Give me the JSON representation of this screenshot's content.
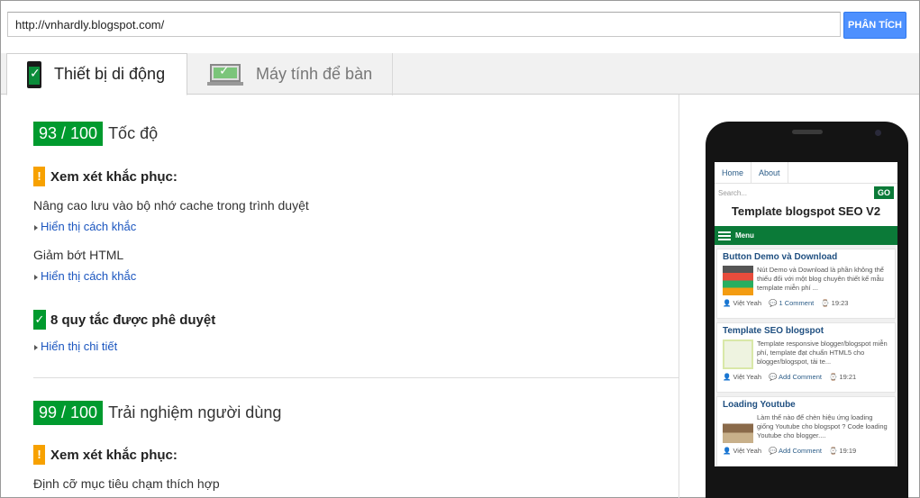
{
  "url_input": {
    "value": "http://vnhardly.blogspot.com/"
  },
  "analyze_button": {
    "label": "PHÂN TÍCH"
  },
  "tabs": [
    {
      "label": "Thiết bị di động",
      "active": true
    },
    {
      "label": "Máy tính để bàn",
      "active": false
    }
  ],
  "speed": {
    "score": "93 / 100",
    "label": "Tốc độ",
    "consider_fixing": "Xem xét khắc phục:",
    "rules": [
      {
        "text": "Nâng cao lưu vào bộ nhớ cache trong trình duyệt",
        "link": "Hiển thị cách khắc"
      },
      {
        "text": "Giảm bớt HTML",
        "link": "Hiển thị cách khắc"
      }
    ],
    "passed": "8 quy tắc được phê duyệt",
    "details_link": "Hiển thị chi tiết"
  },
  "ux": {
    "score": "99 / 100",
    "label": "Trải nghiệm người dùng",
    "consider_fixing": "Xem xét khắc phục:",
    "rules": [
      {
        "text": "Định cỡ mục tiêu chạm thích hợp"
      }
    ]
  },
  "colors": {
    "score_green": "#009a2e",
    "warning_orange": "#f7a100",
    "link_blue": "#1a55bf",
    "button_blue": "#4d90fe"
  },
  "preview": {
    "nav": [
      "Home",
      "About"
    ],
    "search_placeholder": "Search...",
    "go": "GO",
    "blog_title": "Template blogspot SEO V2",
    "menu": "Menu",
    "posts": [
      {
        "title": "Button Demo và Download",
        "excerpt": "Nút Demo và Download là phần không thể thiếu đối với một blog chuyên thiết kế mẫu template miễn phí ...",
        "author": "Việt Yeah",
        "comments": "1 Comment",
        "time": "19:23"
      },
      {
        "title": "Template SEO blogspot",
        "excerpt": "Template responsive blogger/blogspot miễn phí, template đạt chuẩn HTML5 cho blogger/blogspot, tải te...",
        "author": "Việt Yeah",
        "comments": "Add Comment",
        "time": "19:21"
      },
      {
        "title": "Loading Youtube",
        "excerpt": "Làm thế nào để chèn hiệu ứng loading giống Youtube cho blogspot ? Code loading Youtube cho blogger....",
        "author": "Việt Yeah",
        "comments": "Add Comment",
        "time": "19:19"
      }
    ]
  }
}
